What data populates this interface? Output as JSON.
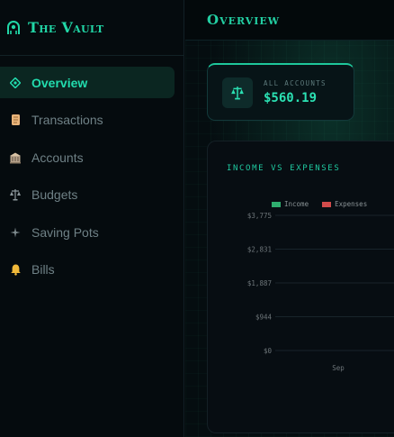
{
  "brand": {
    "title": "The Vault",
    "icon": "vault-icon"
  },
  "nav": [
    {
      "label": "Overview",
      "icon": "overview-icon",
      "active": true
    },
    {
      "label": "Transactions",
      "icon": "scroll-icon",
      "active": false
    },
    {
      "label": "Accounts",
      "icon": "bank-icon",
      "active": false
    },
    {
      "label": "Budgets",
      "icon": "scales-icon",
      "active": false
    },
    {
      "label": "Saving Pots",
      "icon": "sparkle-icon",
      "active": false
    },
    {
      "label": "Bills",
      "icon": "bell-icon",
      "active": false
    }
  ],
  "header": {
    "title": "Overview"
  },
  "summary": {
    "label": "ALL ACCOUNTS",
    "value": "$560.19",
    "icon": "scales-icon"
  },
  "colors": {
    "accent": "#22dcae",
    "income": "#2fae6f",
    "expenses": "#d24b4b"
  },
  "chart_data": {
    "type": "bar",
    "title": "INCOME VS EXPENSES",
    "categories": [
      "Sep"
    ],
    "series": [
      {
        "name": "Income",
        "values": [
          0
        ]
      },
      {
        "name": "Expenses",
        "values": [
          0
        ]
      }
    ],
    "ylim": [
      0,
      3775
    ],
    "yticks": [
      "$3,775",
      "$2,831",
      "$1,887",
      "$944",
      "$0"
    ],
    "grid": true,
    "legend": "top"
  }
}
